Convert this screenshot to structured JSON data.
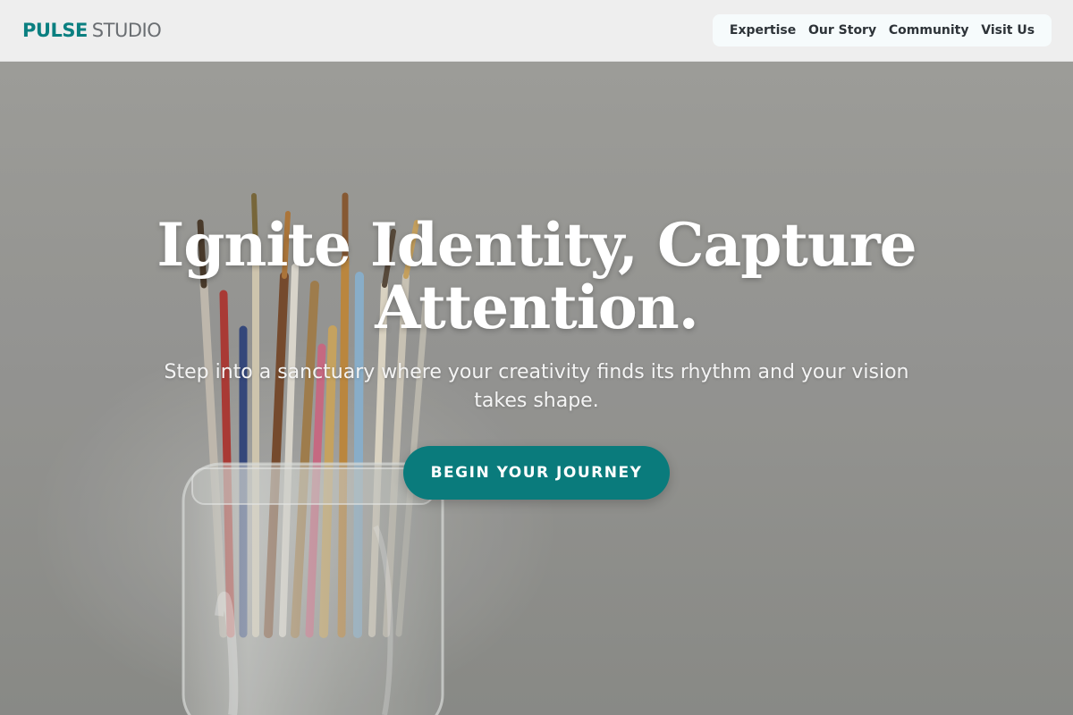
{
  "brand": {
    "name_bold": "PULSE",
    "name_light": "STUDIO",
    "accent": "#0a7f80"
  },
  "nav": {
    "items": [
      {
        "label": "Expertise"
      },
      {
        "label": "Our Story"
      },
      {
        "label": "Community"
      },
      {
        "label": "Visit Us"
      }
    ]
  },
  "hero": {
    "headline": "Ignite Identity, Capture Attention.",
    "subline": "Step into a sanctuary where your creativity finds its rhythm and your vision takes shape.",
    "cta_label": "BEGIN YOUR JOURNEY",
    "cta_color": "#0a7b7c",
    "background_image": "jar-of-paintbrushes-image"
  }
}
